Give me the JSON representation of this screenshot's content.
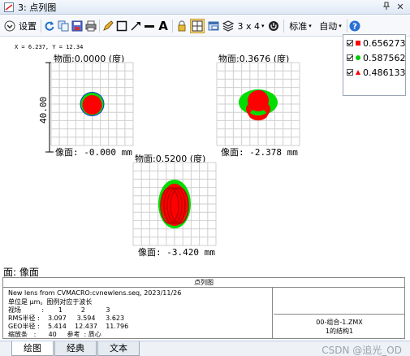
{
  "window": {
    "title": "3: 点列图",
    "pin_icon": "pin-icon",
    "close_icon": "close-icon"
  },
  "toolbar": {
    "settings_label": "设置",
    "layout_label": "3 x 4",
    "standard_label": "标准",
    "auto_label": "自动",
    "font_icon_label": "A",
    "icons": [
      "chevron-circle-icon",
      "refresh-icon",
      "copy-icon",
      "save-icon",
      "print-icon",
      "pencil-icon",
      "rectangle-icon",
      "arrow-icon",
      "line-icon",
      "text-icon",
      "lock-icon",
      "grid-select-icon",
      "window-icon",
      "layers-icon",
      "power-icon",
      "help-icon"
    ]
  },
  "plot": {
    "cursor": "X = 6.237, Y = 12.34",
    "scale_bar": "40.00",
    "panels": [
      {
        "title": "物面:0.0000 (度)",
        "caption": "像面: -0.000 mm"
      },
      {
        "title": "物面:0.3676 (度)",
        "caption": "像面: -2.378 mm"
      },
      {
        "title": "物面:0.5200 (度)",
        "caption": "像面: -3.420 mm"
      }
    ]
  },
  "legend": {
    "items": [
      {
        "wavelength": "0.656273",
        "color": "#ff0000",
        "marker": "square"
      },
      {
        "wavelength": "0.587562",
        "color": "#00cc00",
        "marker": "circle"
      },
      {
        "wavelength": "0.486133",
        "color": "#ff0000",
        "marker": "triangle"
      }
    ]
  },
  "surface_label": "面: 像面",
  "info": {
    "header": "点列图",
    "line1": "New lens from CVMACRO:cvnewlens.seq, 2023/11/26",
    "line2": "单位是 μm。图例对应于波长",
    "line3": "视场          :       1         2          3",
    "line4": "RMS半径 :    3.097     3.594     3.623",
    "line5": "GEO半径 :    5.414    12.437    11.796",
    "line6": "缩放条   :      40     参考  : 质心",
    "side1": "00-组合-1.ZMX",
    "side2": "1的结构1"
  },
  "tabs": [
    "绘图",
    "经典",
    "文本"
  ],
  "watermark": "CSDN @追光_OD",
  "colors": {
    "title_bar": "#dfe8f5",
    "grid_line": "#cfcfcf",
    "spot_red": "#ff0000",
    "spot_green": "#00dd00",
    "spot_blue": "#1a2fd8"
  }
}
